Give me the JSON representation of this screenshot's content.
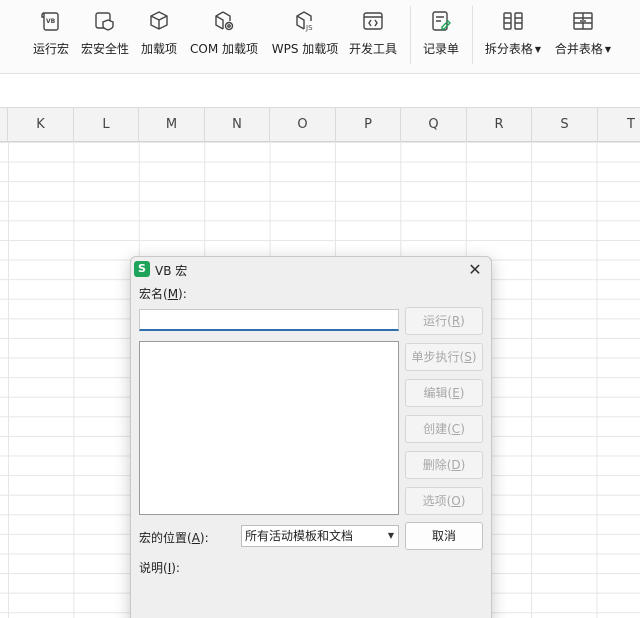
{
  "ribbon": {
    "buttons": [
      {
        "id": "run-macro",
        "label": "运行宏",
        "icon": "vb-script-icon"
      },
      {
        "id": "macro-security",
        "label": "宏安全性",
        "icon": "macro-security-icon"
      },
      {
        "id": "addins",
        "label": "加载项",
        "icon": "cube-icon"
      },
      {
        "id": "com-addins",
        "label": "COM 加载项",
        "icon": "cube-gear-icon"
      },
      {
        "id": "wps-addins",
        "label": "WPS 加载项",
        "icon": "cube-js-icon"
      },
      {
        "id": "dev-tools",
        "label": "开发工具",
        "icon": "code-window-icon"
      },
      {
        "id": "record-sheet",
        "label": "记录单",
        "icon": "record-form-icon"
      },
      {
        "id": "split-table",
        "label": "拆分表格",
        "icon": "split-table-icon"
      },
      {
        "id": "merge-table",
        "label": "合并表格",
        "icon": "merge-table-icon"
      }
    ]
  },
  "grid": {
    "columns": [
      "K",
      "L",
      "M",
      "N",
      "O",
      "P",
      "Q",
      "R",
      "S",
      "T"
    ]
  },
  "dialog": {
    "app_icon_letter": "S",
    "title": "VB 宏",
    "close_glyph": "✕",
    "macro_name_label": "宏名(",
    "macro_name_key": "M",
    "macro_name_suffix": "):",
    "macro_name_value": "",
    "buttons": [
      {
        "label": "运行(",
        "key": "R",
        "enabled": false
      },
      {
        "label": "单步执行(",
        "key": "S",
        "enabled": false
      },
      {
        "label": "编辑(",
        "key": "E",
        "enabled": false
      },
      {
        "label": "创建(",
        "key": "C",
        "enabled": false
      },
      {
        "label": "删除(",
        "key": "D",
        "enabled": false
      },
      {
        "label": "选项(",
        "key": "O",
        "enabled": false
      }
    ],
    "location_label": "宏的位置(",
    "location_key": "A",
    "location_suffix": "):",
    "location_value": "所有活动模板和文档",
    "cancel_label": "取消",
    "description_label": "说明(",
    "description_key": "I",
    "description_suffix": "):"
  }
}
